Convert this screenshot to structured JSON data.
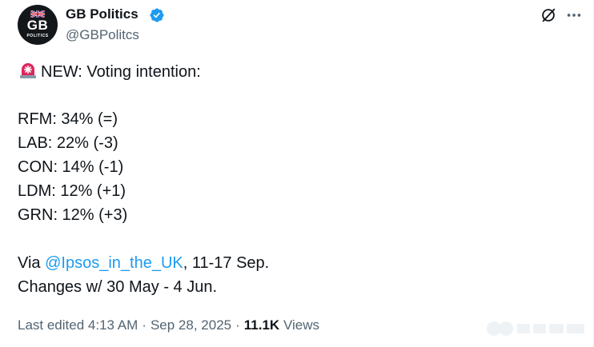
{
  "author": {
    "display_name": "GB Politics",
    "handle": "@GBPolitcs",
    "avatar_text": "GB",
    "avatar_subtext": "POLITICS",
    "verified": true
  },
  "header_icons": [
    "grok-icon",
    "more-icon"
  ],
  "tweet": {
    "lines": [
      "NEW: Voting intention:",
      "",
      "RFM: 34% (=)",
      "LAB: 22% (-3)",
      "CON: 14% (-1)",
      "LDM: 12% (+1)",
      "GRN: 12% (+3)",
      ""
    ],
    "source_prefix": "Via ",
    "source_mention": "@Ipsos_in_the_UK",
    "source_suffix": ", 11-17 Sep.",
    "changes_line": "Changes w/ 30 May - 4 Jun."
  },
  "meta": {
    "edited_label": "Last edited 4:13 AM",
    "separator": "·",
    "date": "Sep 28, 2025",
    "views_count": "11.1K",
    "views_label": " Views"
  },
  "colors": {
    "text": "#0f1419",
    "secondary": "#536471",
    "link": "#1d9bf0",
    "verified": "#1d9bf0",
    "siren": "#e0245e"
  }
}
